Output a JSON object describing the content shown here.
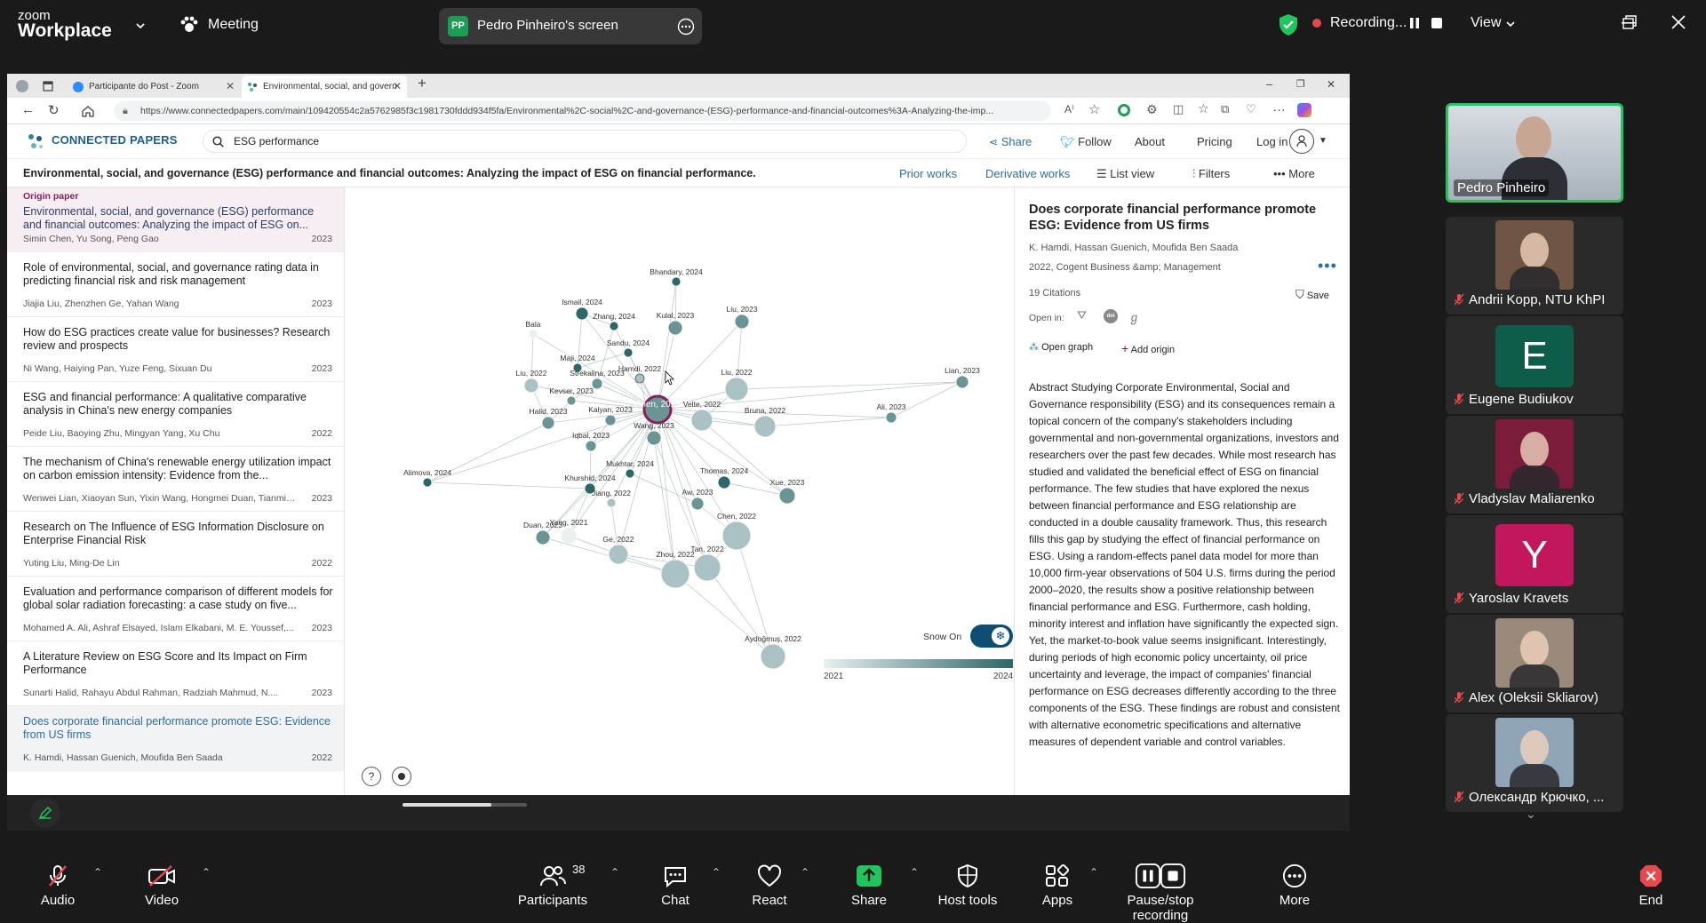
{
  "zoom": {
    "brand_top": "zoom",
    "brand_bottom": "Workplace",
    "meeting_label": "Meeting",
    "share_initials": "PP",
    "share_label": "Pedro Pinheiro's screen",
    "recording_label": "Recording...",
    "view_label": "View",
    "toolbar": [
      {
        "label": "Audio",
        "icon": "mic-muted-icon"
      },
      {
        "label": "Video",
        "icon": "video-off-icon"
      },
      {
        "label": "Participants",
        "icon": "participants-icon",
        "count": "38"
      },
      {
        "label": "Chat",
        "icon": "chat-icon"
      },
      {
        "label": "React",
        "icon": "heart-icon"
      },
      {
        "label": "Share",
        "icon": "share-arrow-icon"
      },
      {
        "label": "Host tools",
        "icon": "shield-icon"
      },
      {
        "label": "Apps",
        "icon": "apps-icon"
      },
      {
        "label": "Pause/stop recording",
        "icon": "pause-stop-icon"
      },
      {
        "label": "More",
        "icon": "more-icon"
      },
      {
        "label": "End",
        "icon": "end-icon"
      }
    ],
    "participants": [
      {
        "name": "Pedro Pinheiro",
        "type": "video",
        "muted": false,
        "active": true,
        "bg": "#c9ced3"
      },
      {
        "name": "Andrii Kopp, NTU KhPI",
        "type": "video",
        "muted": true,
        "bg": "#6e5544"
      },
      {
        "name": "Eugene Budiukov",
        "type": "letter",
        "letter": "E",
        "muted": true,
        "bg": "#0e5c4a"
      },
      {
        "name": "Vladyslav Maliarenko",
        "type": "video",
        "muted": true,
        "bg": "#7a1c3a"
      },
      {
        "name": "Yaroslav Kravets",
        "type": "letter",
        "letter": "Y",
        "muted": true,
        "bg": "#c2185b"
      },
      {
        "name": "Alex (Oleksii Skliarov)",
        "type": "video",
        "muted": true,
        "bg": "#9a8a7c"
      },
      {
        "name": "Олександр Крючко, ...",
        "type": "video",
        "muted": true,
        "bg": "#8fa4b6"
      }
    ]
  },
  "browser": {
    "tabs": [
      {
        "label": "Participante do Post - Zoom",
        "active": false
      },
      {
        "label": "Environmental, social, and govern",
        "active": true
      }
    ],
    "url": "https://www.connectedpapers.com/main/109420554c2a5762985f3c1981730fddd934f5fa/Environmental%2C-social%2C-and-governance-(ESG)-performance-and-financial-outcomes%3A-Analyzing-the-imp..."
  },
  "cp": {
    "logo": "CONNECTED PAPERS",
    "search_value": "ESG performance",
    "nav": {
      "share": "Share",
      "follow": "Follow",
      "about": "About",
      "pricing": "Pricing",
      "login": "Log in"
    },
    "graph_title": "Environmental, social, and governance (ESG) performance and financial outcomes: Analyzing the impact of ESG on financial performance.",
    "tb": {
      "prior": "Prior works",
      "derivative": "Derivative works",
      "list": "List view",
      "filters": "Filters",
      "more": "More"
    },
    "origin_label": "Origin paper",
    "papers": [
      {
        "title": "Environmental, social, and governance (ESG) performance and financial outcomes: Analyzing the impact of ESG on...",
        "authors": "Simin Chen, Yu Song, Peng Gao",
        "year": "2023",
        "state": "origin"
      },
      {
        "title": "Role of environmental, social, and governance rating data in predicting financial risk and risk management",
        "authors": "Jiajia Liu, Zhenzhen Ge, Yahan Wang",
        "year": "2023",
        "state": ""
      },
      {
        "title": "How do ESG practices create value for businesses? Research review and prospects",
        "authors": "Ni Wang, Haiying Pan, Yuze Feng, Sixuan Du",
        "year": "2023",
        "state": ""
      },
      {
        "title": "ESG and financial performance: A qualitative comparative analysis in China's new energy companies",
        "authors": "Peide Liu, Baoying Zhu, Mingyan Yang, Xu Chu",
        "year": "2022",
        "state": ""
      },
      {
        "title": "The mechanism of China's renewable energy utilization impact on carbon emission intensity: Evidence from the...",
        "authors": "Wenwei Lian, Xiaoyan Sun, Yixin Wang, Hongmei Duan, Tianmin...",
        "year": "2023",
        "state": ""
      },
      {
        "title": "Research on The Influence of ESG Information Disclosure on Enterprise Financial Risk",
        "authors": "Yuting Liu, Ming-De Lin",
        "year": "2022",
        "state": ""
      },
      {
        "title": "Evaluation and performance comparison of different models for global solar radiation forecasting: a case study on five...",
        "authors": "Mohamed A. Ali, Ashraf Elsayed, Islam Elkabani, M. E. Youssef,...",
        "year": "2023",
        "state": ""
      },
      {
        "title": "A Literature Review on ESG Score and Its Impact on Firm Performance",
        "authors": "Sunarti Halid, Rahayu Abdul Rahman, Radziah Mahmud, N....",
        "year": "2023",
        "state": ""
      },
      {
        "title": "Does corporate financial performance promote ESG: Evidence from US firms",
        "authors": "K. Hamdi, Hassan Guenich, Moufida Ben Saada",
        "year": "2022",
        "state": "selected"
      }
    ],
    "graph_nodes": [
      {
        "label": "Bhandary, 2024",
        "year": 2024,
        "size": 5
      },
      {
        "label": "Ismail, 2024",
        "year": 2024,
        "size": 7
      },
      {
        "label": "Zhang, 2024",
        "year": 2024,
        "size": 5
      },
      {
        "label": "Kulal, 2023",
        "year": 2023,
        "size": 8
      },
      {
        "label": "Liu, 2023",
        "year": 2023,
        "size": 8
      },
      {
        "label": "Bala",
        "year": 2021,
        "size": 5
      },
      {
        "label": "Sandu, 2024",
        "year": 2024,
        "size": 5
      },
      {
        "label": "Maji, 2024",
        "year": 2024,
        "size": 5
      },
      {
        "label": "Hamdi, 2022",
        "year": 2022,
        "size": 5
      },
      {
        "label": "Liu, 2022",
        "year": 2022,
        "size": 8
      },
      {
        "label": "Liu, 2022",
        "year": 2022,
        "size": 13
      },
      {
        "label": "Strekalina, 2023",
        "year": 2023,
        "size": 6
      },
      {
        "label": "Kevser, 2023",
        "year": 2023,
        "size": 5
      },
      {
        "label": "Chen, 2023",
        "year": 2023,
        "size": 15
      },
      {
        "label": "Lian, 2023",
        "year": 2023,
        "size": 7
      },
      {
        "label": "Ali, 2023",
        "year": 2023,
        "size": 6
      },
      {
        "label": "Halid, 2023",
        "year": 2023,
        "size": 7
      },
      {
        "label": "Kalyan, 2023",
        "year": 2023,
        "size": 6
      },
      {
        "label": "Velte, 2022",
        "year": 2022,
        "size": 12
      },
      {
        "label": "Bruna, 2022",
        "year": 2022,
        "size": 12
      },
      {
        "label": "Iqbal, 2023",
        "year": 2023,
        "size": 6
      },
      {
        "label": "Wang, 2023",
        "year": 2023,
        "size": 8
      },
      {
        "label": "Alimova, 2024",
        "year": 2024,
        "size": 5
      },
      {
        "label": "Mukhtar, 2024",
        "year": 2024,
        "size": 5
      },
      {
        "label": "Khurshid, 2024",
        "year": 2024,
        "size": 6
      },
      {
        "label": "Thomas, 2024",
        "year": 2024,
        "size": 7
      },
      {
        "label": "Xue, 2023",
        "year": 2023,
        "size": 9
      },
      {
        "label": "Jiang, 2022",
        "year": 2022,
        "size": 5
      },
      {
        "label": "Aw, 2023",
        "year": 2023,
        "size": 7
      },
      {
        "label": "Chen, 2022",
        "year": 2022,
        "size": 16
      },
      {
        "label": "Duan, 2023",
        "year": 2023,
        "size": 8
      },
      {
        "label": "Yang, 2021",
        "year": 2021,
        "size": 9
      },
      {
        "label": "Ge, 2022",
        "year": 2022,
        "size": 11
      },
      {
        "label": "Zhou, 2022",
        "year": 2022,
        "size": 16
      },
      {
        "label": "Tan, 2022",
        "year": 2022,
        "size": 15
      },
      {
        "label": "Aydoğmuş, 2022",
        "year": 2022,
        "size": 14
      }
    ],
    "snow_label": "Snow On",
    "timeline_start": "2021",
    "timeline_end": "2024",
    "details": {
      "title": "Does corporate financial performance promote ESG: Evidence from US firms",
      "authors": "K. Hamdi, Hassan Guenich, Moufida Ben Saada",
      "venue": "2022, Cogent Business &amp; Management",
      "citations": "19 Citations",
      "save": "Save",
      "open_in": "Open in:",
      "open_graph": "Open graph",
      "add_origin": "Add origin",
      "abstract": "Abstract Studying Corporate Environmental, Social and Governance responsibility (ESG) and its consequences remain a topical concern of the company's stakeholders including governmental and non-governmental organizations, investors and researchers over the past few decades. While most research has studied and validated the beneficial effect of ESG on financial performance. The few studies that have explored the nexus between financial performance and ESG relationship are conducted in a double causality framework. Thus, this research fills this gap by studying the effect of financial performance on ESG. Using a random-effects panel data model for more than 10,000 firm-year observations of 504 U.S. firms during the period 2000–2020, the results show a positive relationship between financial performance and ESG. Furthermore, cash holding, minority interest and inflation have significantly the expected sign. Yet, the market-to-book value seems insignificant. Interestingly, during periods of high economic policy uncertainty, oil price uncertainty and leverage, the impact of companies' financial performance on ESG decreases differently according to the three components of the ESG. These findings are robust and consistent with alternative econometric specifications and alternative measures of dependent variable and control variables."
    }
  },
  "colors": {
    "zoom_green": "#21c55d",
    "record_red": "#e5484d",
    "cp_blue": "#2c6fa3",
    "node_dark": "#3b6a6c",
    "node_light": "#c9d6d6"
  }
}
